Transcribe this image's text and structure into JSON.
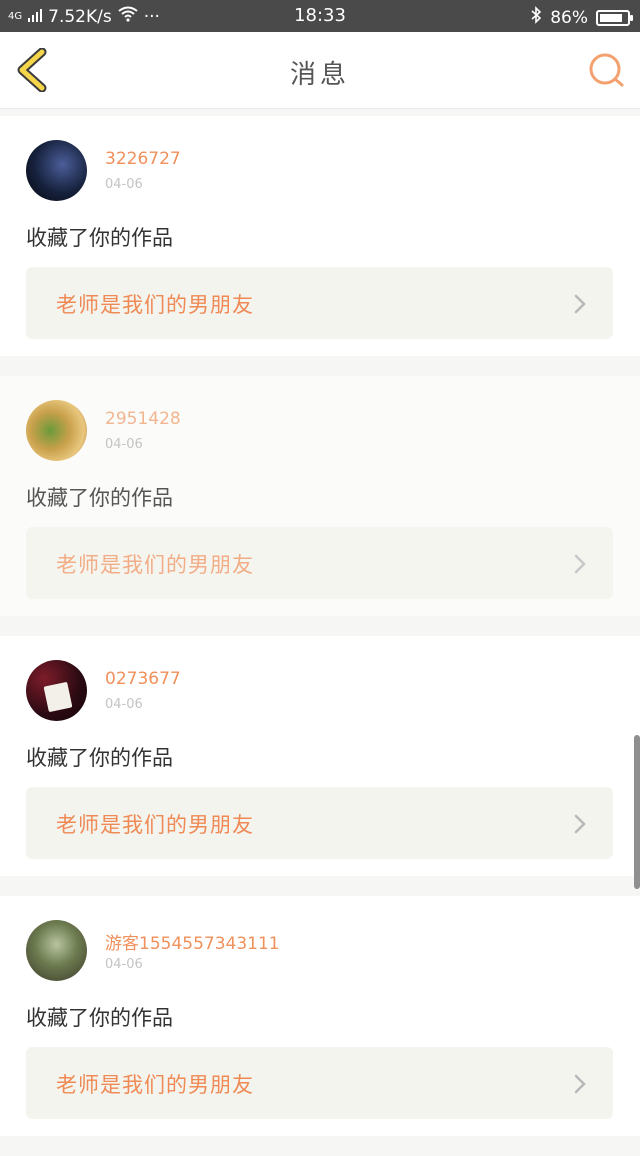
{
  "status_bar": {
    "network": "4G",
    "speed": "7.52K/s",
    "more": "···",
    "time": "18:33",
    "battery_text": "86%",
    "battery_level": 0.86
  },
  "nav": {
    "title": "消息"
  },
  "messages": [
    {
      "username": "3226727",
      "date": "04-06",
      "action": "收藏了你的作品",
      "work_title": "老师是我们的男朋友"
    },
    {
      "username": "2951428",
      "date": "04-06",
      "action": "收藏了你的作品",
      "work_title": "老师是我们的男朋友"
    },
    {
      "username": "0273677",
      "date": "04-06",
      "action": "收藏了你的作品",
      "work_title": "老师是我们的男朋友"
    },
    {
      "username": "游客1554557343111",
      "date": "04-06",
      "action": "收藏了你的作品",
      "work_title": "老师是我们的男朋友"
    }
  ],
  "colors": {
    "accent": "#f0905a",
    "back_icon": "#f5d54a",
    "search_icon": "#f3a16e",
    "status_bar_bg": "#4a4a4a"
  }
}
